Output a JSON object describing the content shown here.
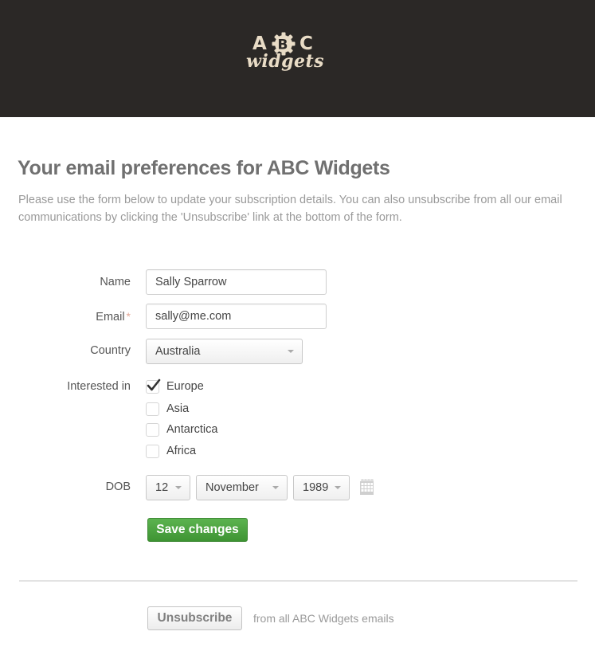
{
  "header": {
    "logo": {
      "letters": [
        "A",
        "B",
        "C"
      ],
      "wordmark": "widgets",
      "color": "#e9dcc6",
      "background": "#2b2826"
    }
  },
  "page": {
    "title": "Your email preferences for ABC Widgets",
    "intro": "Please use the form below to update your subscription details. You can also unsubscribe from all our email communications by clicking the 'Unsubscribe' link at the bottom of the form."
  },
  "form": {
    "name": {
      "label": "Name",
      "value": "Sally Sparrow"
    },
    "email": {
      "label": "Email",
      "required_mark": "*",
      "value": "sally@me.com"
    },
    "country": {
      "label": "Country",
      "selected": "Australia"
    },
    "interests": {
      "label": "Interested in",
      "options": [
        {
          "label": "Europe",
          "checked": true
        },
        {
          "label": "Asia",
          "checked": false
        },
        {
          "label": "Antarctica",
          "checked": false
        },
        {
          "label": "Africa",
          "checked": false
        }
      ]
    },
    "dob": {
      "label": "DOB",
      "day": "12",
      "month": "November",
      "year": "1989",
      "calendar_icon": "calendar-icon"
    },
    "save_label": "Save changes",
    "save_color": "#4aa23f"
  },
  "unsubscribe": {
    "button_label": "Unsubscribe",
    "text": "from all ABC Widgets emails"
  }
}
